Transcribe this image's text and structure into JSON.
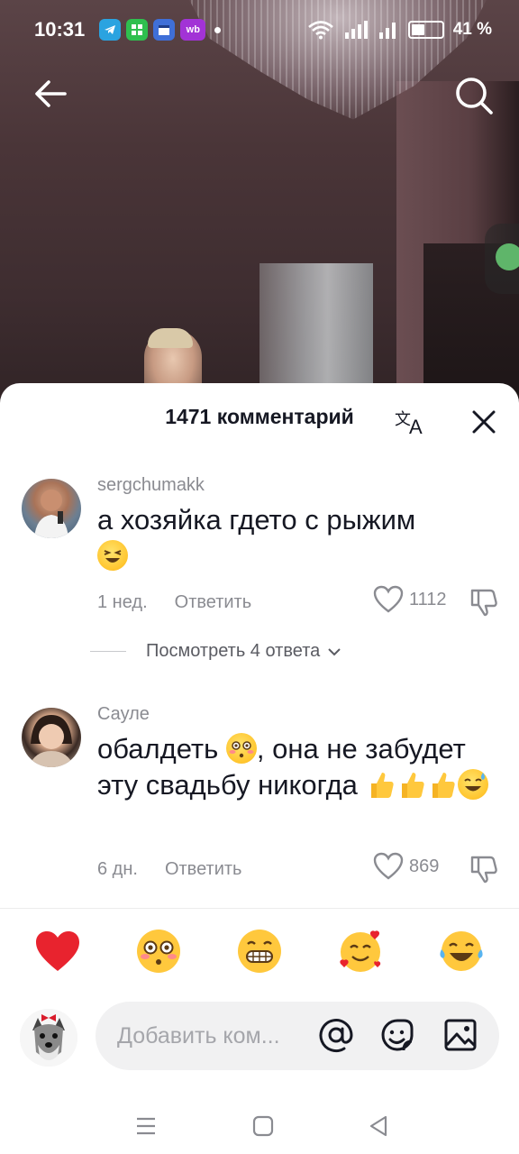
{
  "status_bar": {
    "time": "10:31",
    "app_icons": [
      "telegram-icon",
      "grid-app-icon",
      "calendar-app-icon",
      "wildberries-icon"
    ],
    "wb_label": "wb",
    "battery_percent": "41 %"
  },
  "video": {
    "back_icon": "arrow-left-icon",
    "search_icon": "search-icon"
  },
  "comments_sheet": {
    "title": "1471 комментарий",
    "translate_icon": "translate-icon",
    "close_icon": "close-icon",
    "comments": [
      {
        "username": "sergchumakk",
        "text": "а хозяйка гдето с рыжим",
        "emojis": [
          "laughing-squint-emoji"
        ],
        "age": "1 нед.",
        "reply_label": "Ответить",
        "likes": "1112",
        "view_replies": "Посмотреть 4 ответа"
      },
      {
        "username": "Сауле",
        "text_part1": "обалдеть",
        "text_part2": ", она не забудет эту свадьбу никогда",
        "emojis": [
          "flushed-emoji",
          "thumbs-up-emoji",
          "thumbs-up-emoji",
          "thumbs-up-emoji",
          "sweat-smile-emoji"
        ],
        "age": "6 дн.",
        "reply_label": "Ответить",
        "likes": "869"
      }
    ],
    "quick_reactions": [
      "red-heart-emoji",
      "flushed-emoji",
      "grinning-emoji",
      "smiling-hearts-emoji",
      "tears-of-joy-emoji"
    ],
    "input": {
      "placeholder": "Добавить ком...",
      "mention_icon": "at-icon",
      "emoji_icon": "emoji-icon",
      "image_icon": "image-icon"
    }
  },
  "nav_bar": {
    "items": [
      "menu-icon",
      "home-square-icon",
      "back-triangle-icon"
    ]
  },
  "colors": {
    "text_primary": "#161823",
    "text_secondary": "#8a8b91",
    "input_bg": "#f1f1f2"
  }
}
